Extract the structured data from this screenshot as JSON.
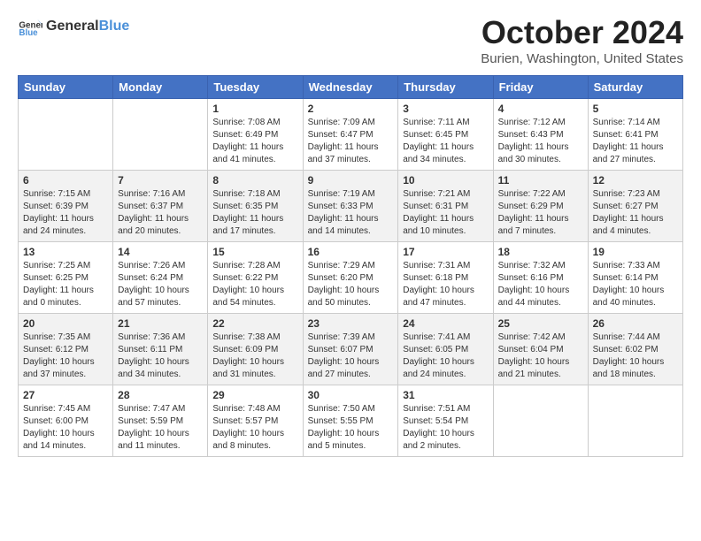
{
  "header": {
    "logo_general": "General",
    "logo_blue": "Blue",
    "month_title": "October 2024",
    "location": "Burien, Washington, United States"
  },
  "weekdays": [
    "Sunday",
    "Monday",
    "Tuesday",
    "Wednesday",
    "Thursday",
    "Friday",
    "Saturday"
  ],
  "weeks": [
    [
      {
        "day": "",
        "info": ""
      },
      {
        "day": "",
        "info": ""
      },
      {
        "day": "1",
        "info": "Sunrise: 7:08 AM\nSunset: 6:49 PM\nDaylight: 11 hours and 41 minutes."
      },
      {
        "day": "2",
        "info": "Sunrise: 7:09 AM\nSunset: 6:47 PM\nDaylight: 11 hours and 37 minutes."
      },
      {
        "day": "3",
        "info": "Sunrise: 7:11 AM\nSunset: 6:45 PM\nDaylight: 11 hours and 34 minutes."
      },
      {
        "day": "4",
        "info": "Sunrise: 7:12 AM\nSunset: 6:43 PM\nDaylight: 11 hours and 30 minutes."
      },
      {
        "day": "5",
        "info": "Sunrise: 7:14 AM\nSunset: 6:41 PM\nDaylight: 11 hours and 27 minutes."
      }
    ],
    [
      {
        "day": "6",
        "info": "Sunrise: 7:15 AM\nSunset: 6:39 PM\nDaylight: 11 hours and 24 minutes."
      },
      {
        "day": "7",
        "info": "Sunrise: 7:16 AM\nSunset: 6:37 PM\nDaylight: 11 hours and 20 minutes."
      },
      {
        "day": "8",
        "info": "Sunrise: 7:18 AM\nSunset: 6:35 PM\nDaylight: 11 hours and 17 minutes."
      },
      {
        "day": "9",
        "info": "Sunrise: 7:19 AM\nSunset: 6:33 PM\nDaylight: 11 hours and 14 minutes."
      },
      {
        "day": "10",
        "info": "Sunrise: 7:21 AM\nSunset: 6:31 PM\nDaylight: 11 hours and 10 minutes."
      },
      {
        "day": "11",
        "info": "Sunrise: 7:22 AM\nSunset: 6:29 PM\nDaylight: 11 hours and 7 minutes."
      },
      {
        "day": "12",
        "info": "Sunrise: 7:23 AM\nSunset: 6:27 PM\nDaylight: 11 hours and 4 minutes."
      }
    ],
    [
      {
        "day": "13",
        "info": "Sunrise: 7:25 AM\nSunset: 6:25 PM\nDaylight: 11 hours and 0 minutes."
      },
      {
        "day": "14",
        "info": "Sunrise: 7:26 AM\nSunset: 6:24 PM\nDaylight: 10 hours and 57 minutes."
      },
      {
        "day": "15",
        "info": "Sunrise: 7:28 AM\nSunset: 6:22 PM\nDaylight: 10 hours and 54 minutes."
      },
      {
        "day": "16",
        "info": "Sunrise: 7:29 AM\nSunset: 6:20 PM\nDaylight: 10 hours and 50 minutes."
      },
      {
        "day": "17",
        "info": "Sunrise: 7:31 AM\nSunset: 6:18 PM\nDaylight: 10 hours and 47 minutes."
      },
      {
        "day": "18",
        "info": "Sunrise: 7:32 AM\nSunset: 6:16 PM\nDaylight: 10 hours and 44 minutes."
      },
      {
        "day": "19",
        "info": "Sunrise: 7:33 AM\nSunset: 6:14 PM\nDaylight: 10 hours and 40 minutes."
      }
    ],
    [
      {
        "day": "20",
        "info": "Sunrise: 7:35 AM\nSunset: 6:12 PM\nDaylight: 10 hours and 37 minutes."
      },
      {
        "day": "21",
        "info": "Sunrise: 7:36 AM\nSunset: 6:11 PM\nDaylight: 10 hours and 34 minutes."
      },
      {
        "day": "22",
        "info": "Sunrise: 7:38 AM\nSunset: 6:09 PM\nDaylight: 10 hours and 31 minutes."
      },
      {
        "day": "23",
        "info": "Sunrise: 7:39 AM\nSunset: 6:07 PM\nDaylight: 10 hours and 27 minutes."
      },
      {
        "day": "24",
        "info": "Sunrise: 7:41 AM\nSunset: 6:05 PM\nDaylight: 10 hours and 24 minutes."
      },
      {
        "day": "25",
        "info": "Sunrise: 7:42 AM\nSunset: 6:04 PM\nDaylight: 10 hours and 21 minutes."
      },
      {
        "day": "26",
        "info": "Sunrise: 7:44 AM\nSunset: 6:02 PM\nDaylight: 10 hours and 18 minutes."
      }
    ],
    [
      {
        "day": "27",
        "info": "Sunrise: 7:45 AM\nSunset: 6:00 PM\nDaylight: 10 hours and 14 minutes."
      },
      {
        "day": "28",
        "info": "Sunrise: 7:47 AM\nSunset: 5:59 PM\nDaylight: 10 hours and 11 minutes."
      },
      {
        "day": "29",
        "info": "Sunrise: 7:48 AM\nSunset: 5:57 PM\nDaylight: 10 hours and 8 minutes."
      },
      {
        "day": "30",
        "info": "Sunrise: 7:50 AM\nSunset: 5:55 PM\nDaylight: 10 hours and 5 minutes."
      },
      {
        "day": "31",
        "info": "Sunrise: 7:51 AM\nSunset: 5:54 PM\nDaylight: 10 hours and 2 minutes."
      },
      {
        "day": "",
        "info": ""
      },
      {
        "day": "",
        "info": ""
      }
    ]
  ]
}
